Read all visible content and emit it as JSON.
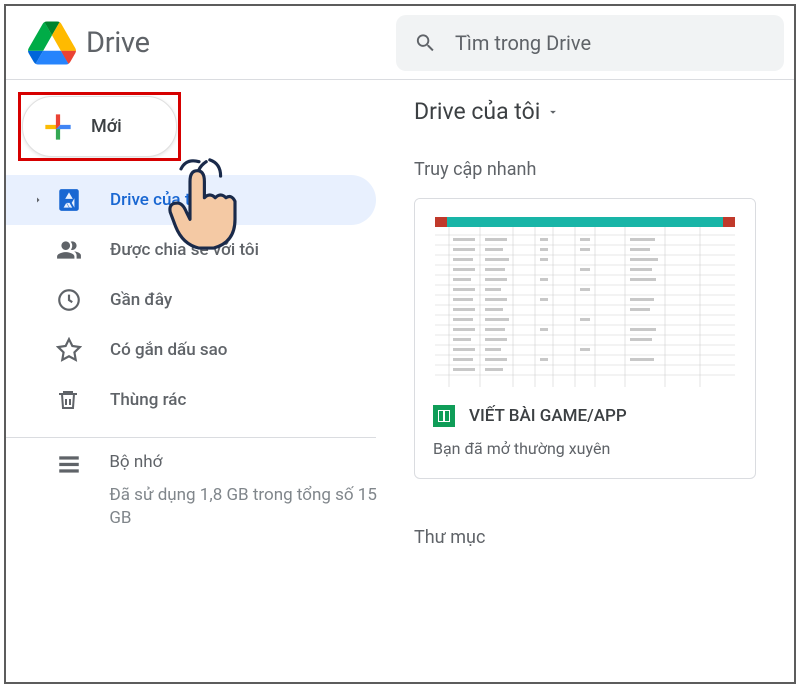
{
  "header": {
    "app_name": "Drive",
    "search_placeholder": "Tìm trong Drive"
  },
  "sidebar": {
    "new_button_label": "Mới",
    "nav": [
      {
        "icon": "drive",
        "label": "Drive của tôi",
        "active": true,
        "expandable": true
      },
      {
        "icon": "shared",
        "label": "Được chia sẻ với tôi",
        "active": false
      },
      {
        "icon": "recent",
        "label": "Gần đây",
        "active": false
      },
      {
        "icon": "starred",
        "label": "Có gắn dấu sao",
        "active": false
      },
      {
        "icon": "trash",
        "label": "Thùng rác",
        "active": false
      }
    ],
    "storage": {
      "title": "Bộ nhớ",
      "detail": "Đã sử dụng 1,8 GB trong tổng số 15 GB"
    }
  },
  "main": {
    "breadcrumb_title": "Drive của tôi",
    "quick_access_title": "Truy cập nhanh",
    "file": {
      "name": "VIẾT BÀI GAME/APP",
      "subtitle": "Bạn đã mở thường xuyên",
      "type": "sheets"
    },
    "folders_title": "Thư mục"
  },
  "colors": {
    "accent_blue": "#1967d2",
    "bg_active": "#e8f0fe",
    "highlight_red": "#d60000"
  }
}
